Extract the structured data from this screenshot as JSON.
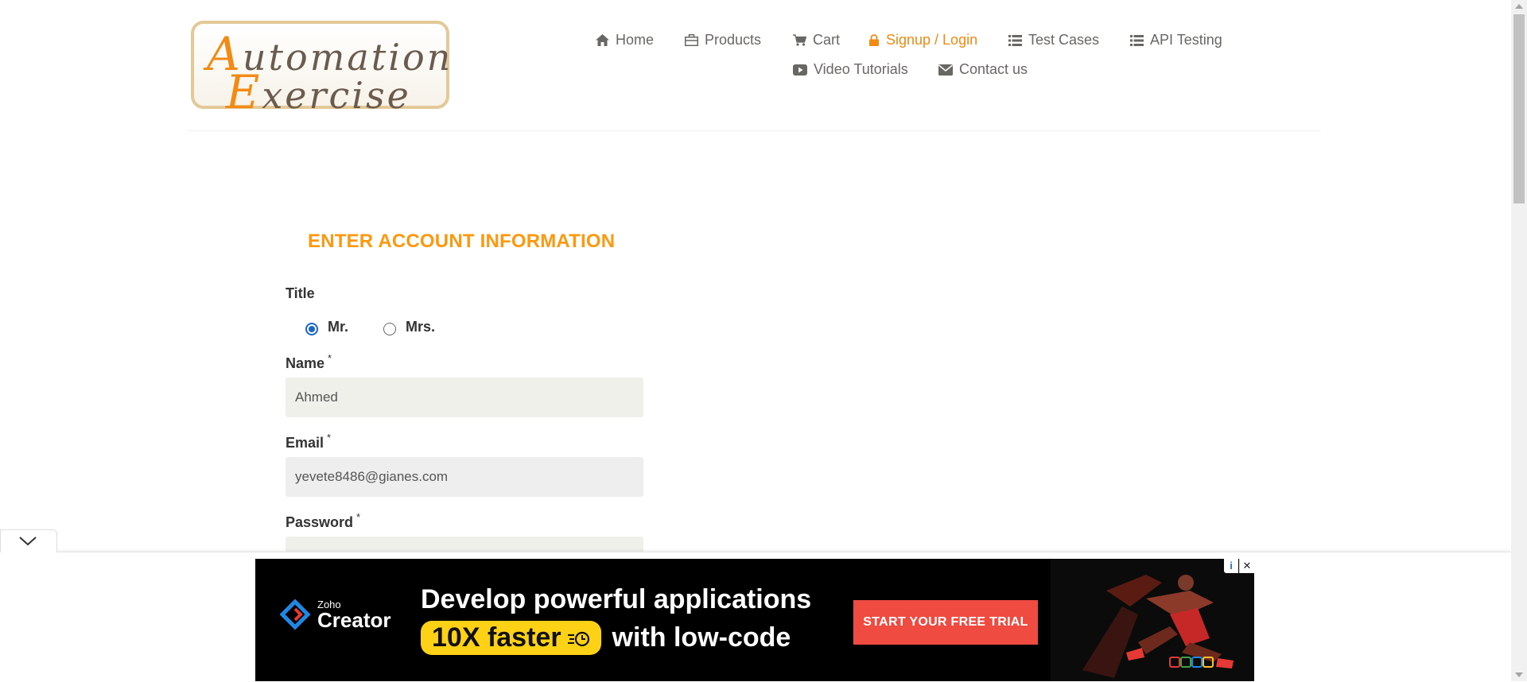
{
  "brand": {
    "logo_line1_first": "A",
    "logo_line1_rest": "utomation",
    "logo_line2_first": "E",
    "logo_line2_rest": "xercise"
  },
  "nav": {
    "home": {
      "label": "Home",
      "icon": "home-icon"
    },
    "products": {
      "label": "Products",
      "icon": "briefcase-icon"
    },
    "cart": {
      "label": "Cart",
      "icon": "cart-icon"
    },
    "signup_login": {
      "label": "Signup / Login",
      "icon": "lock-icon",
      "active": true
    },
    "test_cases": {
      "label": "Test Cases",
      "icon": "list-icon"
    },
    "api_testing": {
      "label": "API Testing",
      "icon": "list-icon"
    },
    "video_tutorials": {
      "label": "Video Tutorials",
      "icon": "youtube-icon"
    },
    "contact_us": {
      "label": "Contact us",
      "icon": "envelope-icon"
    }
  },
  "form": {
    "heading": "ENTER ACCOUNT INFORMATION",
    "title_label": "Title",
    "title_options": [
      {
        "label": "Mr.",
        "checked": true
      },
      {
        "label": "Mrs.",
        "checked": false
      }
    ],
    "name_label": "Name",
    "name_value": "Ahmed",
    "email_label": "Email",
    "email_value": "yevete8486@gianes.com",
    "password_label": "Password",
    "password_value": "",
    "required_mark": "*"
  },
  "ad": {
    "brand_small": "Zoho",
    "brand_large": "Creator",
    "headline": "Develop powerful applications",
    "highlight": "10X faster",
    "headline_tail": "with low-code",
    "cta": "START YOUR FREE TRIAL",
    "info_glyph": "i",
    "close_glyph": "✕"
  },
  "colors": {
    "accent": "#fe980f",
    "nav_text": "#696763",
    "radio_checked": "#1a66c9",
    "ad_background": "#000000",
    "ad_cta": "#f04b41",
    "ad_highlight": "#fcd116"
  }
}
